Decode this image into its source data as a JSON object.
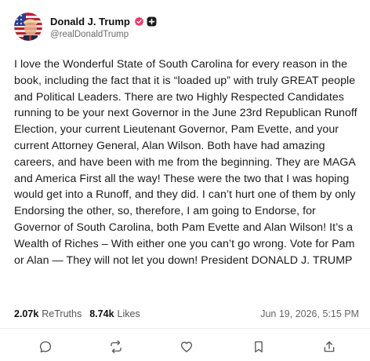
{
  "post": {
    "display_name": "Donald J. Trump",
    "handle": "@realDonaldTrump",
    "body": "I love the Wonderful State of South Carolina for every reason in the book, including the fact that it is “loaded up” with truly GREAT people and Political Leaders. There are two Highly Respected Candidates running to be your next Governor in the June 23rd Republican Runoff Election, your current Lieutenant Governor, Pam Evette, and your current Attorney General, Alan Wilson. Both have had amazing careers, and have been with me from the beginning. They are MAGA and America First all the way! These were the two that I was hoping would get into a Runoff, and they did. I can’t hurt one of them by only Endorsing the other, so, therefore, I am going to Endorse, for Governor of South Carolina, both Pam Evette and Alan Wilson! It’s a Wealth of Riches – With either one you can’t go wrong. Vote for Pam or Alan — They will not let you down! President DONALD J. TRUMP",
    "retruths_count": "2.07k",
    "retruths_label": "ReTruths",
    "likes_count": "8.74k",
    "likes_label": "Likes",
    "timestamp": "Jun 19, 2026, 5:15 PM"
  },
  "icons": {
    "verified": "verified-badge-icon",
    "plus": "plus-badge-icon",
    "reply": "reply-icon",
    "retruth": "retruth-icon",
    "like": "heart-icon",
    "bookmark": "bookmark-icon",
    "share": "share-icon"
  },
  "colors": {
    "verified_badge": "#e8386a",
    "text": "#1a1a1a",
    "muted": "#6b6b6b",
    "icon": "#555555"
  }
}
